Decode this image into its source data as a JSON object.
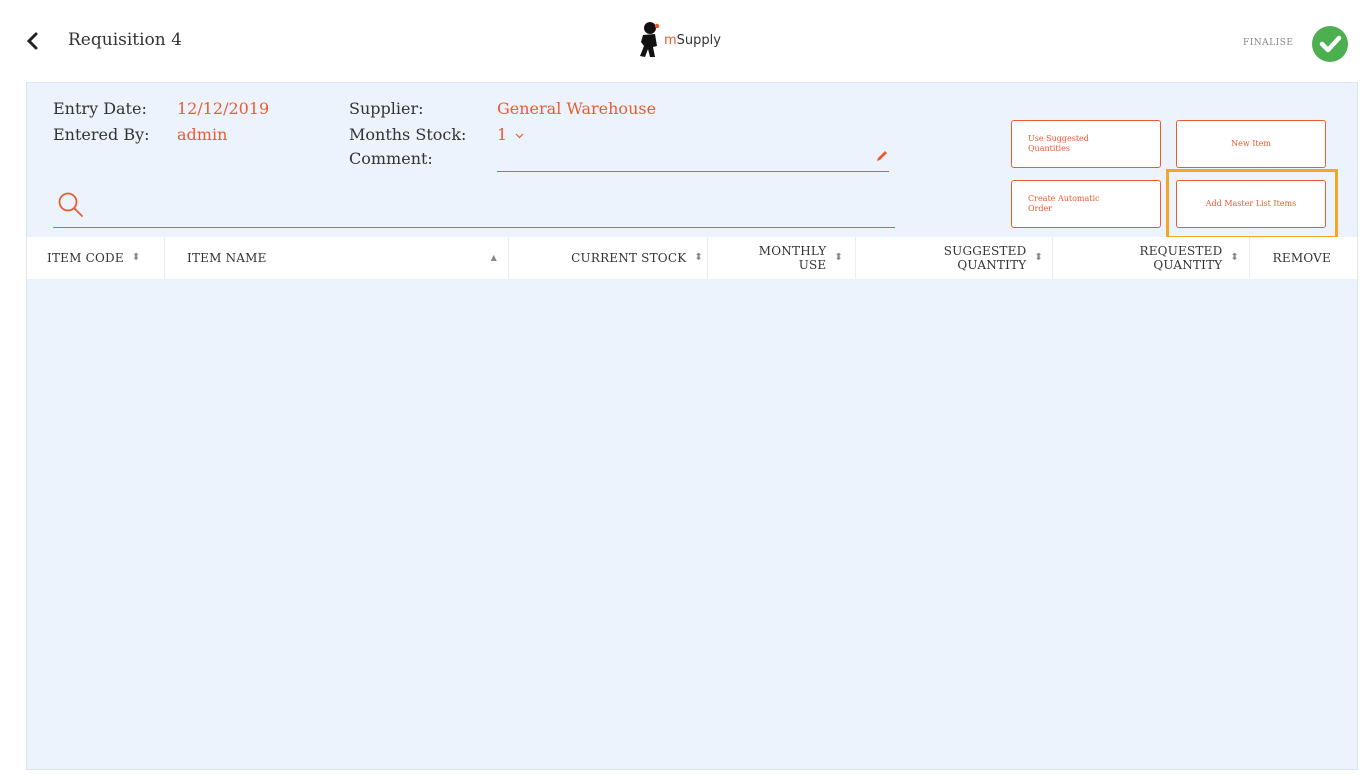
{
  "header": {
    "title": "Requisition 4",
    "logo_m": "m",
    "logo_text": "Supply",
    "finalise_label": "FINALISE"
  },
  "info": {
    "entry_date_label": "Entry Date:",
    "entry_date_value": "12/12/2019",
    "entered_by_label": "Entered By:",
    "entered_by_value": "admin",
    "supplier_label": "Supplier:",
    "supplier_value": "General Warehouse",
    "months_stock_label": "Months Stock:",
    "months_stock_value": "1",
    "comment_label": "Comment:",
    "comment_value": ""
  },
  "search": {
    "value": "",
    "placeholder": ""
  },
  "buttons": {
    "use_suggested": "Use Suggested Quantities",
    "new_item": "New Item",
    "create_automatic": "Create Automatic Order",
    "add_master_list": "Add Master List Items"
  },
  "table": {
    "columns": {
      "item_code": "ITEM CODE",
      "item_name": "ITEM NAME",
      "current_stock": "CURRENT STOCK",
      "monthly_use_1": "MONTHLY",
      "monthly_use_2": "USE",
      "suggested_1": "SUGGESTED",
      "suggested_2": "QUANTITY",
      "requested_1": "REQUESTED",
      "requested_2": "QUANTITY",
      "remove": "REMOVE"
    },
    "rows": []
  },
  "colors": {
    "accent": "#e95c30",
    "finalise": "#4caf50",
    "panel_bg": "#edf3fc",
    "highlight": "#f5a623"
  },
  "icons": [
    "back-arrow-icon",
    "msupply-logo-icon",
    "check-icon",
    "pencil-icon",
    "search-icon",
    "sort-icon",
    "sort-up-icon",
    "chevron-down-icon"
  ]
}
